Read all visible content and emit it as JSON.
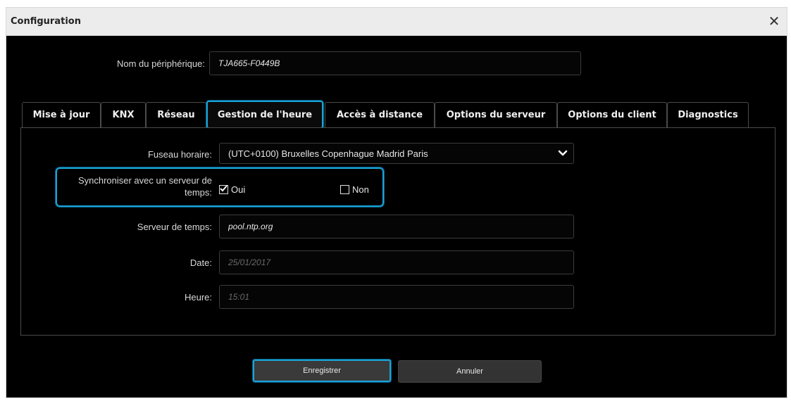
{
  "window": {
    "title": "Configuration",
    "close_symbol": "✕"
  },
  "device": {
    "label": "Nom du périphérique:",
    "value": "TJA665-F0449B"
  },
  "tabs": [
    {
      "label": "Mise à jour",
      "active": false
    },
    {
      "label": "KNX",
      "active": false
    },
    {
      "label": "Réseau",
      "active": false
    },
    {
      "label": "Gestion de l'heure",
      "active": true
    },
    {
      "label": "Accès à distance",
      "active": false
    },
    {
      "label": "Options du serveur",
      "active": false
    },
    {
      "label": "Options du client",
      "active": false
    },
    {
      "label": "Diagnostics",
      "active": false
    }
  ],
  "form": {
    "timezone": {
      "label": "Fuseau horaire:",
      "value": "(UTC+0100) Bruxelles Copenhague Madrid Paris"
    },
    "sync": {
      "label": "Synchroniser avec un serveur de temps:",
      "yes": "Oui",
      "no": "Non",
      "yes_checked": true,
      "no_checked": false
    },
    "time_server": {
      "label": "Serveur de temps:",
      "value": "pool.ntp.org"
    },
    "date": {
      "label": "Date:",
      "value": "25/01/2017"
    },
    "time": {
      "label": "Heure:",
      "value": "15:01"
    }
  },
  "buttons": {
    "save": "Enregistrer",
    "cancel": "Annuler"
  },
  "colors": {
    "accent": "#1aa3d8",
    "background": "#000000",
    "titlebar": "#ececec"
  }
}
